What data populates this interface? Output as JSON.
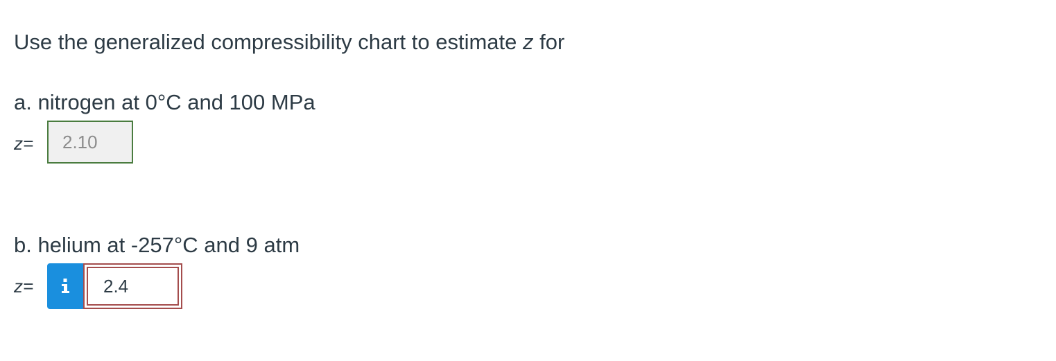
{
  "question": {
    "intro_before": "Use the generalized compressibility chart to estimate ",
    "intro_var": "z",
    "intro_after": " for"
  },
  "part_a": {
    "label": "a. nitrogen at 0°C and 100 MPa",
    "z_label": "z=",
    "answer_value": "2.10",
    "status_color": "#4a7c3f"
  },
  "part_b": {
    "label": "b. helium at -257°C and 9 atm",
    "z_label": "z=",
    "info_icon": "info-icon",
    "answer_value": "2.4",
    "status_color": "#a44d4d",
    "info_color": "#1a8fde"
  }
}
